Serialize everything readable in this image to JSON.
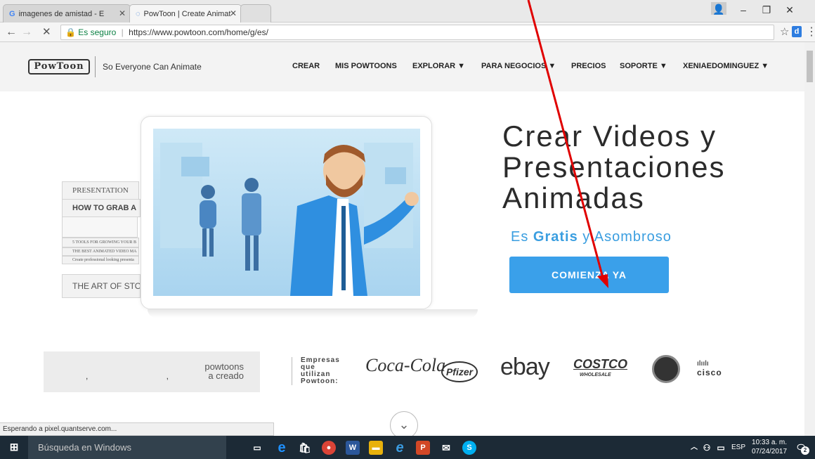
{
  "browser": {
    "tabs": [
      {
        "title": "imagenes de amistad - E"
      },
      {
        "title": "PowToon | Create Animat"
      }
    ],
    "address": {
      "secure_label": "Es seguro",
      "url": "https://www.powtoon.com/home/g/es/"
    },
    "status_text": "Esperando a pixel.quantserve.com..."
  },
  "site": {
    "logo": "PowToon",
    "tagline": "So Everyone Can Animate",
    "nav": [
      "CREAR",
      "MIS POWTOONS",
      "EXPLORAR ▼",
      "PARA NEGOCIOS ▼",
      "PRECIOS",
      "SOPORTE ▼",
      "XENIAEDOMINGUEZ ▼"
    ],
    "hero": {
      "title_line1": "Crear Videos y",
      "title_line2": "Presentaciones",
      "title_line3": "Animadas",
      "sub_prefix": "Es",
      "sub_bold": "Gratis",
      "sub_suffix": "y Asombroso",
      "cta": "COMIENZA YA"
    },
    "books": [
      "PRESENTATION",
      "HOW TO GRAB A",
      "5 TOOLS FOR GROWING YOUR B",
      "THE BEST ANIMATED VIDEO MA",
      "Create professional looking presenta",
      "THE ART OF STORY"
    ],
    "stats": {
      "commas": ", ,",
      "label_line1": "powtoons",
      "label_line2": "a creado"
    },
    "companies_label": [
      "Empresas",
      "que",
      "utilizan",
      "Powtoon:"
    ],
    "brands": [
      "Coca-Cola",
      "Pfizer",
      "ebay",
      "COSTCO",
      "WHOLESALE",
      "cisco"
    ]
  },
  "taskbar": {
    "search_placeholder": "Búsqueda en Windows",
    "lang": "ESP",
    "time": "10:33 a. m.",
    "date": "07/24/2017",
    "notifications": "2"
  },
  "colors": {
    "accent": "#3aa0ea",
    "taskbar": "#1c2a36",
    "annotation": "#e00000"
  }
}
